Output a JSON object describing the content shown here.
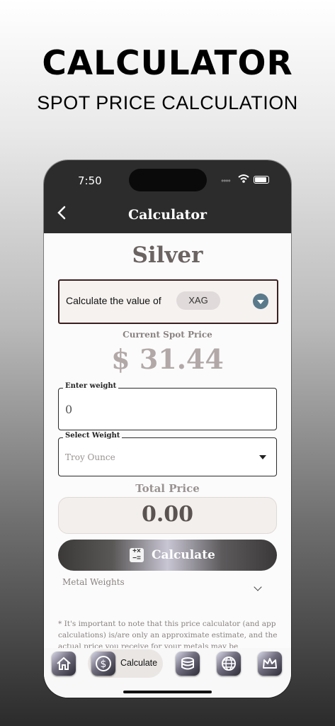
{
  "promo": {
    "title": "CALCULATOR",
    "subtitle": "SPOT PRICE CALCULATION"
  },
  "status_bar": {
    "time": "7:50"
  },
  "nav": {
    "title": "Calculator",
    "back_icon": "chevron-left-icon"
  },
  "main": {
    "metal_name": "Silver",
    "calc_value_label": "Calculate the value of",
    "metal_code": "XAG",
    "spot_label": "Current Spot Price",
    "spot_price": "$ 31.44",
    "weight_field": {
      "label": "Enter weight",
      "value": "0"
    },
    "unit_select": {
      "label": "Select Weight",
      "value": "Troy Ounce"
    },
    "total_label": "Total Price",
    "total_value": "0.00",
    "calculate_button": "Calculate",
    "metal_weights_label": "Metal Weights",
    "disclaimer": "* It's important to note that this price calculator (and app calculations) is/are only an approximate estimate, and the actual price you receive for your metals may be"
  },
  "tabbar": {
    "items": [
      {
        "icon": "home-icon"
      },
      {
        "icon": "dollar-coin-icon",
        "label": "Calculate",
        "active": true
      },
      {
        "icon": "coin-stack-icon"
      },
      {
        "icon": "globe-icon"
      },
      {
        "icon": "crown-icon"
      }
    ]
  },
  "colors": {
    "header_bg": "#2d2c2c",
    "accent_blue": "#5a7a8c",
    "text_muted": "#8a8281"
  }
}
